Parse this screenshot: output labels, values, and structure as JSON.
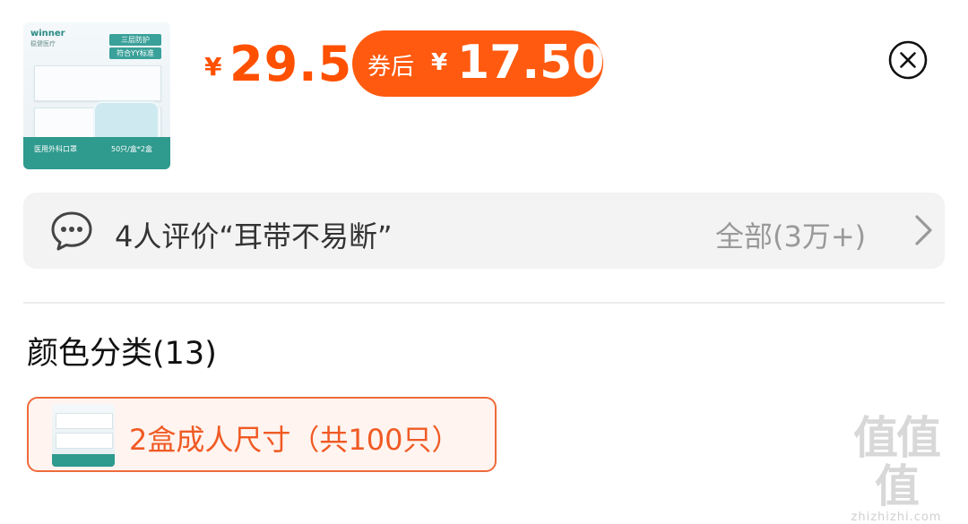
{
  "product": {
    "thumbnail": {
      "brand": "winner",
      "brand_sub": "稳健医疗",
      "tag1": "三层防护",
      "tag2": "符合YY标准",
      "bottom_left": "医用外科口罩",
      "bottom_right": "50只/盒*2盒"
    },
    "currency": "¥",
    "price": "29.5",
    "coupon": {
      "label": "券后",
      "currency": "¥",
      "price": "17.50"
    }
  },
  "close_icon": "circle-x-icon",
  "review": {
    "icon": "chat-bubble-icon",
    "text": "4人评价“耳带不易断”",
    "all_link": "全部(3万+)",
    "chevron_icon": "chevron-right-icon"
  },
  "variants": {
    "title": "颜色分类(13)",
    "options": [
      {
        "label": "2盒成人尺寸（共100只）",
        "selected": true
      }
    ]
  },
  "watermark": {
    "glyphs": "值值值",
    "text": "zhizhizhi.com"
  },
  "colors": {
    "accent": "#ff5000",
    "coupon_bg": "#ff5a0f",
    "selected_border": "#ef6a3a",
    "selected_bg": "#fff4ef",
    "teal": "#2f9a8e"
  }
}
